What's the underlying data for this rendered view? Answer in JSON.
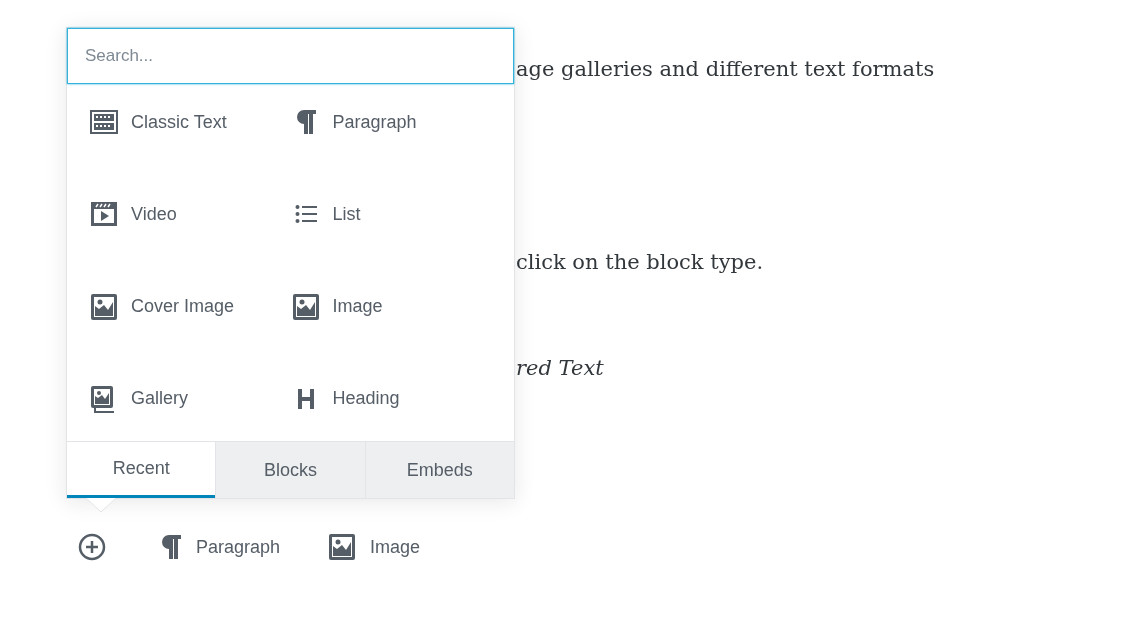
{
  "content_lines": [
    {
      "kind": "plain",
      "text": "age galleries and different text formats"
    },
    {
      "kind": "plain",
      "text": "click on the block type."
    },
    {
      "kind": "italic",
      "text": "red Text"
    }
  ],
  "inserter": {
    "search": {
      "placeholder": "Search..."
    },
    "blocks": [
      {
        "kind": "classic",
        "label": "Classic Text"
      },
      {
        "kind": "paragraph",
        "label": "Paragraph"
      },
      {
        "kind": "video",
        "label": "Video"
      },
      {
        "kind": "list",
        "label": "List"
      },
      {
        "kind": "image",
        "label": "Cover Image"
      },
      {
        "kind": "image",
        "label": "Image"
      },
      {
        "kind": "gallery",
        "label": "Gallery"
      },
      {
        "kind": "heading",
        "label": "Heading"
      }
    ],
    "tabs": [
      {
        "label": "Recent",
        "selected": true
      },
      {
        "label": "Blocks",
        "selected": false
      },
      {
        "label": "Embeds",
        "selected": false
      }
    ]
  },
  "toolbar": [
    {
      "kind": "paragraph",
      "label": "Paragraph"
    },
    {
      "kind": "image",
      "label": "Image"
    }
  ]
}
